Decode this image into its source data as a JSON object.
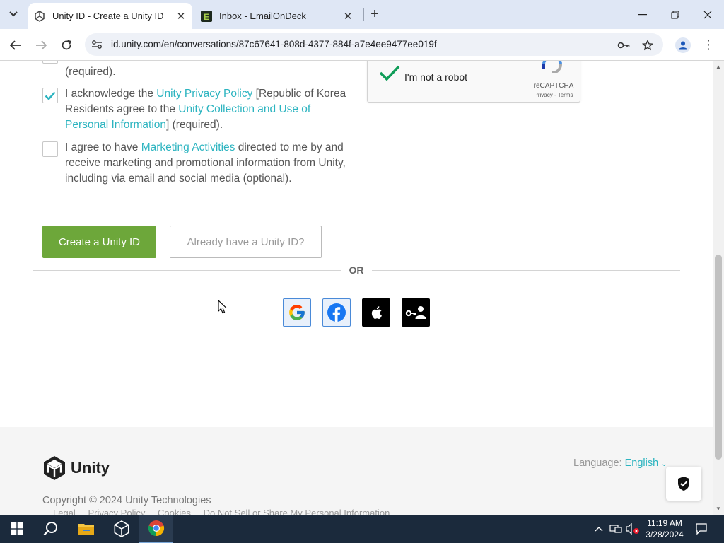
{
  "browser": {
    "tabs": [
      {
        "title": "Unity ID - Create a Unity ID",
        "active": true
      },
      {
        "title": "Inbox - EmailOnDeck",
        "active": false
      }
    ],
    "url": "id.unity.com/en/conversations/87c67641-808d-4377-884f-a7e4ee9477ee019f"
  },
  "form": {
    "partial_required": "(required).",
    "privacy": {
      "checked": true,
      "text_1": "I acknowledge the ",
      "link_1": "Unity Privacy Policy",
      "text_2": " [Republic of Korea Residents agree to the ",
      "link_2": "Unity Collection and Use of Personal Information",
      "text_3": "] (required)."
    },
    "marketing": {
      "checked": false,
      "text_1": "I agree to have ",
      "link_1": "Marketing Activities",
      "text_2": " directed to me by and receive marketing and promotional information from Unity, including via email and social media (optional)."
    },
    "recaptcha": {
      "label": "I'm not a robot",
      "brand": "reCAPTCHA",
      "terms": "Privacy - Terms",
      "checked": true
    },
    "create_button": "Create a Unity ID",
    "have_account_button": "Already have a Unity ID?",
    "or_label": "OR",
    "social_providers": [
      "google",
      "facebook",
      "apple",
      "sso"
    ]
  },
  "footer": {
    "brand": "Unity",
    "language_label": "Language: ",
    "language_value": "English",
    "copyright": "Copyright © 2024 Unity Technologies",
    "links": [
      "Legal",
      "Privacy Policy",
      "Cookies",
      "Do Not Sell or Share My Personal Information"
    ]
  },
  "taskbar": {
    "time": "11:19 AM",
    "date": "3/28/2024"
  },
  "colors": {
    "accent_link": "#2cb4c0",
    "create_button": "#6da73a",
    "taskbar": "#1b2a3c"
  }
}
